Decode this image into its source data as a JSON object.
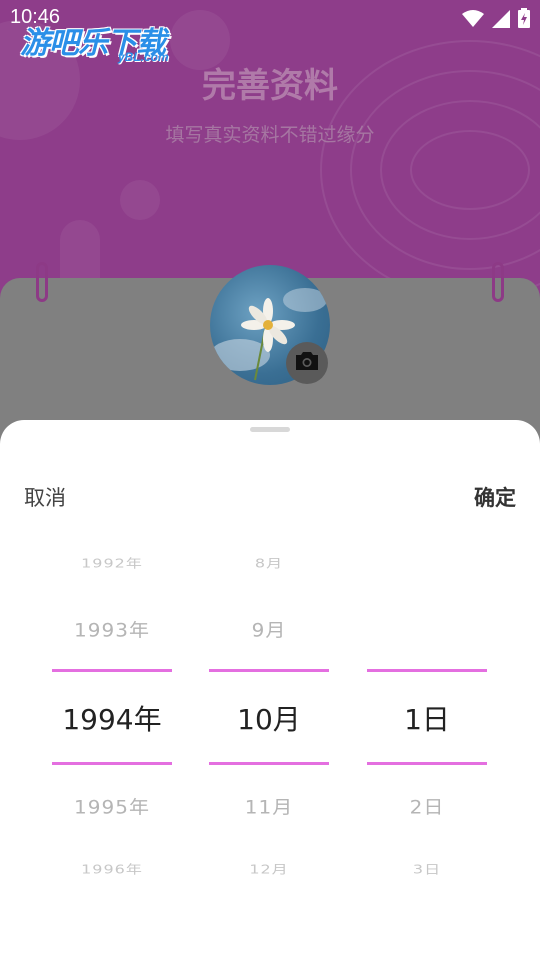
{
  "status_bar": {
    "time": "10:46"
  },
  "watermark": {
    "main": "游吧乐下载",
    "sub": "yBL.com"
  },
  "header": {
    "title": "完善资料",
    "subtitle": "填写真实资料不错过缘分"
  },
  "icons": {
    "wifi": "wifi-icon",
    "signal": "signal-icon",
    "battery": "battery-icon",
    "camera": "camera-icon"
  },
  "colors": {
    "header_bg": "#8e3d8a",
    "accent_line": "#e46fe0",
    "selected_text": "#222222"
  },
  "date_picker": {
    "cancel_label": "取消",
    "confirm_label": "确定",
    "year": {
      "far_top": "1992年",
      "near_top": "1993年",
      "selected": "1994年",
      "near_bottom": "1995年",
      "far_bottom": "1996年"
    },
    "month": {
      "far_top": "8月",
      "near_top": "9月",
      "selected": "10月",
      "near_bottom": "11月",
      "far_bottom": "12月"
    },
    "day": {
      "far_top": "",
      "near_top": "",
      "selected": "1日",
      "near_bottom": "2日",
      "far_bottom": "3日"
    }
  }
}
